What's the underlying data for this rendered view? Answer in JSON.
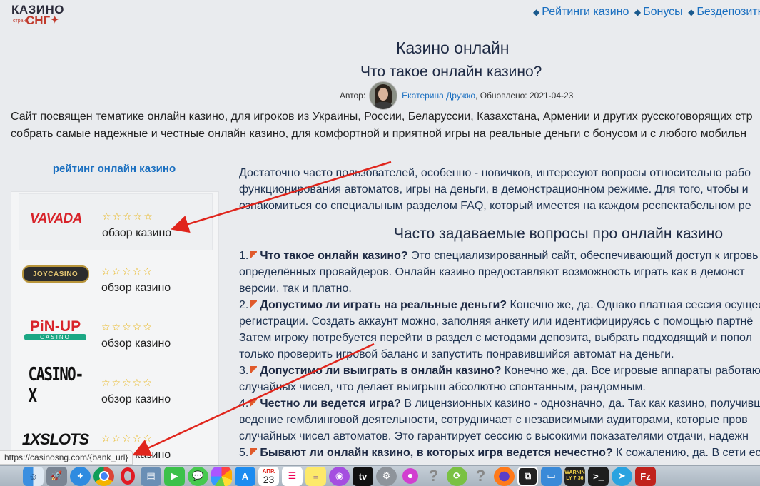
{
  "logo": {
    "line1": "КАЗИНО",
    "small": "стран",
    "line2": "СНГ"
  },
  "nav": {
    "items": [
      "Рейтинги казино",
      "Бонусы",
      "Бездепозитн"
    ]
  },
  "header": {
    "title": "Казино онлайн",
    "subtitle": "Что такое онлайн казино?"
  },
  "author": {
    "label": "Автор:",
    "name": "Екатерина Дружко",
    "updated": ", Обновлено: 2021-04-23"
  },
  "intro": [
    "Сайт посвящен тематике онлайн казино, для игроков из Украины, России, Беларуссии, Казахстана, Армении и других русскоговорящих стр",
    "собрать самые надежные и честные онлайн казино, для комфортной и приятной игры на реальные деньги с бонусом и с любого мобильн"
  ],
  "sidebar": {
    "title": "рейтинг онлайн казино",
    "review_label": "обзор казино",
    "stars": "☆☆☆☆☆",
    "brands": [
      "VAVADA",
      "JOYCASINO",
      "PiN-UP",
      "CASINO",
      "CASINO-X",
      "1XSLOTS"
    ]
  },
  "content": {
    "lines": [
      "Достаточно часто пользователей, особенно - новичков, интересуют вопросы относительно рабо",
      "функционирования автоматов, игры на деньги, в демонстрационном режиме. Для того, чтобы и",
      "ознакомиться со специальным разделом FAQ, который имеется на каждом респектабельном ре"
    ]
  },
  "faq": {
    "title": "Часто задаваемые вопросы про онлайн казино",
    "items": [
      {
        "num": "1.",
        "q": "Что такое онлайн казино?",
        "a": " Это специализированный сайт, обеспечивающий доступ к игровь",
        "more": [
          "определённых провайдеров. Онлайн казино предоставляют возможность играть как в демонст",
          "версии, так и платно."
        ]
      },
      {
        "num": "2.",
        "q": "Допустимо ли играть на реальные деньги?",
        "a": " Конечно же, да. Однако платная сессия осущест",
        "more": [
          "регистрации. Создать аккаунт можно, заполняя анкету или идентифицируясь с помощью партнё",
          "Затем игроку потребуется перейти в раздел с методами депозита, выбрать подходящий и попол",
          "только проверить игровой баланс и запустить понравившийся автомат на деньги."
        ]
      },
      {
        "num": "3.",
        "q": "Допустимо ли выиграть в онлайн казино?",
        "a": " Конечно же, да. Все игровые аппараты работают",
        "more": [
          "случайных чисел, что делает выигрыш абсолютно спонтанным, рандомным."
        ]
      },
      {
        "num": "4.",
        "q": "Честно ли ведется игра?",
        "a": " В лицензионных казино - однозначно, да. Так как казино, получивш",
        "more": [
          "ведение гемблинговой деятельности, сотрудничает с независимыми аудиторами, которые пров",
          "случайных чисел автоматов. Это гарантирует сессию с высокими показателями отдачи, надежн"
        ]
      },
      {
        "num": "5.",
        "q": "Бывают ли онлайн казино, в которых игра ведется нечестно?",
        "a": " К сожалению, да. В сети есть р",
        "more": []
      }
    ]
  },
  "statusbar": {
    "url": "https://casinosng.com/{bank_url}"
  },
  "dock": {
    "calendar_month": "АПР.",
    "calendar_day": "23",
    "warning_text": "WARNIN",
    "warning_time": "LY 7:36",
    "icons": [
      "finder-icon",
      "launchpad-icon",
      "safari-icon",
      "chrome-icon",
      "opera-icon",
      "preview-icon",
      "facetime-icon",
      "messages-icon",
      "photos-icon",
      "appstore-icon",
      "calendar-icon",
      "reminders-icon",
      "notes-icon",
      "podcasts-icon",
      "appletv-icon",
      "system-preferences-icon",
      "unknown-icon",
      "unknown-icon",
      "unknown-icon",
      "unknown-icon",
      "firefox-icon",
      "frame-icon",
      "finder-window-icon",
      "console-icon",
      "terminal-icon",
      "telegram-icon",
      "filezilla-icon"
    ],
    "accent": "#d8232a"
  }
}
